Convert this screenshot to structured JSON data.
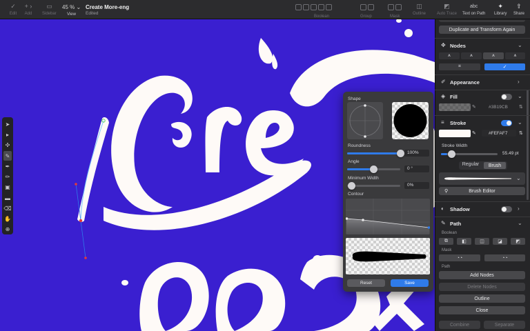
{
  "toolbar": {
    "edit_label": "Edit",
    "add_label": "Add",
    "sidebar_label": "Sidebar",
    "zoom_value": "45 %",
    "view_label": "View",
    "doc_title": "Create More-eng",
    "doc_status": "Edited",
    "boolean_label": "Boolean",
    "group_label": "Group",
    "mask_label": "Mask",
    "outline_label": "Outline",
    "auto_trace_label": "Auto Trace",
    "text_on_path_label": "Text on Path",
    "text_on_path_icon_text": "abc",
    "library_label": "Library",
    "share_label": "Share"
  },
  "popover": {
    "shape_label": "Shape",
    "roundness_label": "Roundness",
    "roundness_value": "100%",
    "angle_label": "Angle",
    "angle_value": "0 °",
    "min_width_label": "Minimum Width",
    "min_width_value": "0%",
    "contour_label": "Contour",
    "reset_label": "Reset",
    "save_label": "Save"
  },
  "inspector": {
    "duplicate_transform_label": "Duplicate and Transform Again",
    "nodes_title": "Nodes",
    "appearance_title": "Appearance",
    "fill_title": "Fill",
    "fill_hex": "#3B19CB",
    "stroke_title": "Stroke",
    "stroke_hex": "#FEFAF7",
    "stroke_width_label": "Stroke Width",
    "stroke_width_value": "55.49 pt",
    "regular_label": "Regular",
    "brush_label": "Brush",
    "brush_editor_label": "Brush Editor",
    "shadow_title": "Shadow",
    "path_title": "Path",
    "boolean_label": "Boolean",
    "mask_label": "Mask",
    "path_label": "Path",
    "add_nodes_label": "Add Nodes",
    "delete_nodes_label": "Delete Nodes",
    "outline_label": "Outline",
    "close_label": "Close",
    "combine_label": "Combine",
    "separate_label": "Separate"
  },
  "values": {
    "stroke_width_fraction": 0.12,
    "roundness_percent": 100,
    "angle_fraction": 0.5,
    "min_width_percent": 0
  },
  "colors": {
    "canvas_bg": "#3A1FD0",
    "fill_color": "#3B19CB",
    "stroke_color": "#FEFAF7",
    "accent": "#2F7BEA"
  },
  "icons": {
    "tools": [
      "select-arrow-icon",
      "direct-select-icon",
      "node-tool-icon",
      "brush-tool-icon",
      "pen-tool-icon",
      "pencil-tool-icon",
      "text-tool-icon",
      "rectangle-tool-icon",
      "eraser-tool-icon",
      "hand-tool-icon",
      "zoom-tool-icon"
    ]
  }
}
